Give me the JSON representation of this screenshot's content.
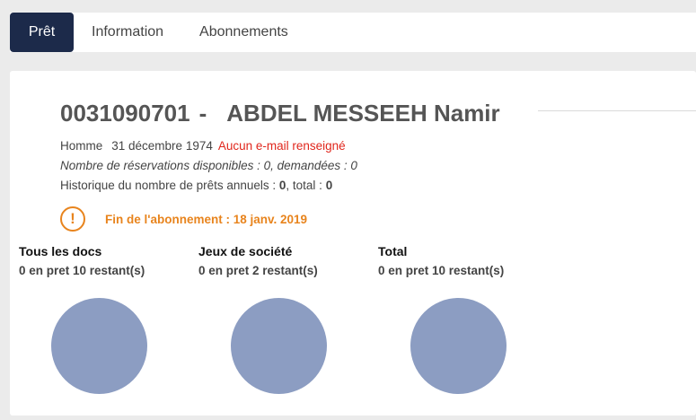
{
  "tabs": [
    {
      "label": "Prêt",
      "active": true
    },
    {
      "label": "Information",
      "active": false
    },
    {
      "label": "Abonnements",
      "active": false
    }
  ],
  "patron": {
    "id": "0031090701",
    "separator": "-",
    "name": "ABDEL MESSEEH Namir",
    "gender": "Homme",
    "birth_date": "31 décembre 1974",
    "email_status": "Aucun e-mail renseigné",
    "reservations_text": "Nombre de réservations disponibles : 0, demandées : 0",
    "history_label": "Historique du nombre de prêts annuels : ",
    "history_annual": "0",
    "history_total_label": ", total : ",
    "history_total": "0"
  },
  "subscription_warning": {
    "icon": "exclamation-icon",
    "text": "Fin de l'abonnement : 18 janv. 2019",
    "color": "#e8841d"
  },
  "quotas": [
    {
      "title": "Tous les docs",
      "summary": "0 en pret 10 restant(s)",
      "on_loan": 0,
      "remaining": 10
    },
    {
      "title": "Jeux de société",
      "summary": "0 en pret 2 restant(s)",
      "on_loan": 0,
      "remaining": 2
    },
    {
      "title": "Total",
      "summary": "0 en pret 10 restant(s)",
      "on_loan": 0,
      "remaining": 10
    }
  ],
  "colors": {
    "active_tab": "#1c2a4a",
    "warning": "#e8841d",
    "email_missing": "#e0261c",
    "quota_circle": "#8c9dc2"
  }
}
